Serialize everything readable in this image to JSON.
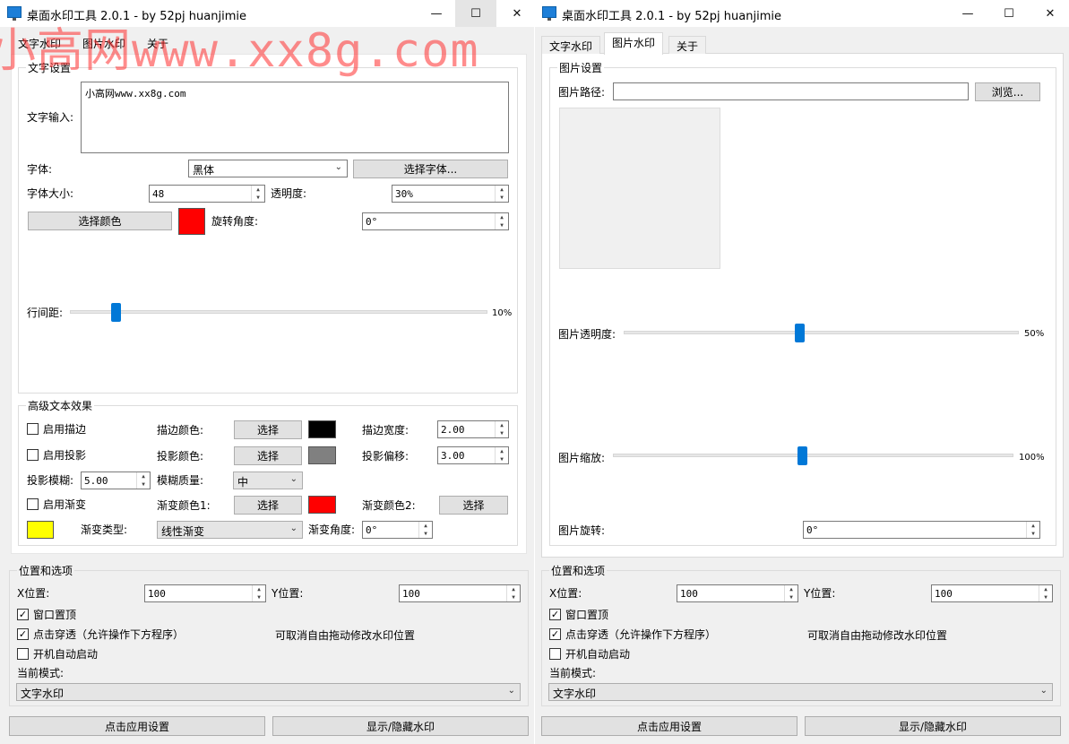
{
  "watermark_text": "小高网www.xx8g.com",
  "left": {
    "title": "桌面水印工具 2.0.1 - by 52pj huanjimie",
    "tabs": [
      "文字水印",
      "图片水印",
      "关于"
    ],
    "text_settings": {
      "group": "文字设置",
      "text_input_label": "文字输入:",
      "text_input_value": "小高网www.xx8g.com",
      "font_label": "字体:",
      "font_value": "黑体",
      "choose_font": "选择字体...",
      "font_size_label": "字体大小:",
      "font_size_value": "48",
      "opacity_label": "透明度:",
      "opacity_value": "30%",
      "choose_color": "选择颜色",
      "text_color": "#ff0000",
      "rotation_label": "旋转角度:",
      "rotation_value": "0°",
      "line_spacing_label": "行间距:",
      "line_spacing_value": "10%",
      "line_spacing_level": 10
    },
    "advanced": {
      "group": "高级文本效果",
      "enable_stroke": "启用描边",
      "stroke_color_label": "描边颜色:",
      "stroke_select": "选择",
      "stroke_color": "#000000",
      "stroke_width_label": "描边宽度:",
      "stroke_width_value": "2.00",
      "enable_shadow": "启用投影",
      "shadow_color_label": "投影颜色:",
      "shadow_select": "选择",
      "shadow_color": "#808080",
      "shadow_offset_label": "投影偏移:",
      "shadow_offset_value": "3.00",
      "shadow_blur_label": "投影模糊:",
      "shadow_blur_value": "5.00",
      "blur_quality_label": "模糊质量:",
      "blur_quality_value": "中",
      "enable_gradient": "启用渐变",
      "gradient_color1_label": "渐变颜色1:",
      "gradient_select1": "选择",
      "gradient_color1": "#ff0000",
      "gradient_color2_label": "渐变颜色2:",
      "gradient_select2": "选择",
      "gradient_color2": "#ffff00",
      "gradient_type_label": "渐变类型:",
      "gradient_type_value": "线性渐变",
      "gradient_angle_label": "渐变角度:",
      "gradient_angle_value": "0°"
    },
    "position": {
      "group": "位置和选项",
      "x_label": "X位置:",
      "x_value": "100",
      "y_label": "Y位置:",
      "y_value": "100",
      "topmost": "窗口置顶",
      "click_through": "点击穿透（允许操作下方程序）",
      "drag_hint": "可取消自由拖动修改水印位置",
      "autostart": "开机自动启动",
      "mode_label": "当前模式:",
      "mode_value": "文字水印"
    },
    "apply_button": "点击应用设置",
    "toggle_button": "显示/隐藏水印"
  },
  "right": {
    "title": "桌面水印工具 2.0.1 - by 52pj huanjimie",
    "tabs": [
      "文字水印",
      "图片水印",
      "关于"
    ],
    "image_settings": {
      "group": "图片设置",
      "path_label": "图片路径:",
      "path_value": "",
      "browse": "浏览...",
      "opacity_label": "图片透明度:",
      "opacity_value": "50%",
      "opacity_level": 50,
      "scale_label": "图片缩放:",
      "scale_value": "100%",
      "scale_level": 100,
      "rotation_label": "图片旋转:",
      "rotation_value": "0°"
    },
    "position": {
      "group": "位置和选项",
      "x_label": "X位置:",
      "x_value": "100",
      "y_label": "Y位置:",
      "y_value": "100",
      "topmost": "窗口置顶",
      "click_through": "点击穿透（允许操作下方程序）",
      "drag_hint": "可取消自由拖动修改水印位置",
      "autostart": "开机自动启动",
      "mode_label": "当前模式:",
      "mode_value": "文字水印"
    },
    "apply_button": "点击应用设置",
    "toggle_button": "显示/隐藏水印"
  },
  "icons": {
    "minimize": "minimize-icon",
    "maximize": "maximize-icon",
    "close": "close-icon",
    "app": "app-monitor-icon"
  }
}
